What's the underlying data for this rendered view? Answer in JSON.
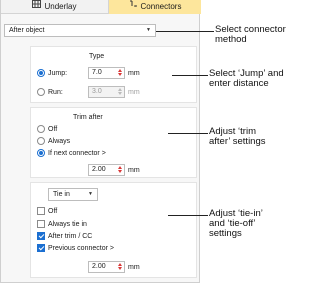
{
  "tabs": {
    "underlay_label": "Underlay",
    "underlay_icon": "underlay-grid-icon",
    "connectors_label": "Connectors",
    "connectors_icon": "connector-icon"
  },
  "connector_method": {
    "value": "After object"
  },
  "type": {
    "title": "Type",
    "jump_label": "Jump:",
    "jump_value": "7.0",
    "jump_unit": "mm",
    "jump_selected": true,
    "run_label": "Run:",
    "run_value": "3.0",
    "run_unit": "mm"
  },
  "trim_after": {
    "title": "Trim after",
    "off_label": "Off",
    "always_label": "Always",
    "if_next_label": "If next connector >",
    "if_next_selected": true,
    "length_value": "2.00",
    "length_unit": "mm"
  },
  "tie": {
    "mode_value": "Tie in",
    "off_label": "Off",
    "always_label": "Always tie in",
    "after_trim_label": "After trim / CC",
    "after_trim_checked": true,
    "previous_label": "Previous connector >",
    "previous_checked": true,
    "length_value": "2.00",
    "length_unit": "mm"
  },
  "callouts": {
    "c1_line1": "Select connector",
    "c1_line2": "method",
    "c2_line1": "Select ‘Jump’ and",
    "c2_line2": "enter distance",
    "c3_line1": "Adjust ‘trim",
    "c3_line2": "after’ settings",
    "c4_line1": "Adjust ‘tie-in’",
    "c4_line2": "and ‘tie-off’",
    "c4_line3": "settings"
  },
  "colors": {
    "active_tab": "#fde69c",
    "accent": "#1b6fd1",
    "spinner_arrow": "#d93636"
  }
}
